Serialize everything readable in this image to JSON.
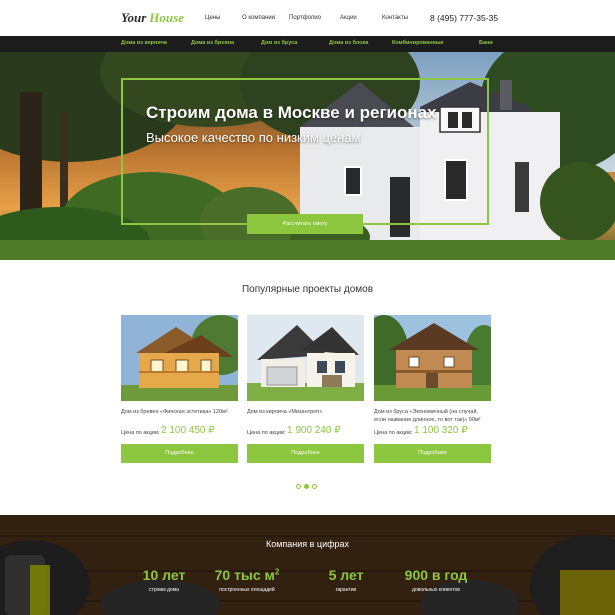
{
  "header": {
    "logo_part1": "Your",
    "logo_part2": "House",
    "nav": [
      {
        "label": "Цены"
      },
      {
        "label": "О компании"
      },
      {
        "label": "Портфолио"
      },
      {
        "label": "Акции"
      },
      {
        "label": "Контакты"
      }
    ],
    "phone": "8 (495) 777-35-35"
  },
  "categories": [
    {
      "label": "Дома из кирпича"
    },
    {
      "label": "Дома из бревна"
    },
    {
      "label": "Дом из бруса"
    },
    {
      "label": "Дома из блока"
    },
    {
      "label": "Комбинированные"
    },
    {
      "label": "Бани"
    }
  ],
  "hero": {
    "title": "Строим дома в Москве и регионах",
    "subtitle": "Высокое качество по низким ценам",
    "button": "Рассчитать смету"
  },
  "projects": {
    "title": "Популярные проекты домов",
    "items": [
      {
        "name": "Дом из бревен «Финская эстетика» 120м²",
        "price_label": "Цена по акции:",
        "price": "2 100 450 ₽",
        "button": "Подробнее"
      },
      {
        "name": "Дом из кирпича «Мизантроп»",
        "price_label": "Цена по акции:",
        "price": "1 900 240 ₽",
        "button": "Подробнее"
      },
      {
        "name": "Дом из бруса «Экономичный (на случай, если название длинное, то вот так)» 90м²",
        "price_label": "Цена по акции:",
        "price": "1 100 320 ₽",
        "button": "Подробнее"
      }
    ],
    "slider": {
      "count": 3,
      "active": 2
    }
  },
  "stats": {
    "title": "Компания в цифрах",
    "items": [
      {
        "value": "10 лет",
        "sup": "",
        "label": "строим дома"
      },
      {
        "value": "70 тыс м",
        "sup": "2",
        "label": "построенных площадей"
      },
      {
        "value": "5 лет",
        "sup": "",
        "label": "гарантии"
      },
      {
        "value": "900 в год",
        "sup": "",
        "label": "довольных клиентов"
      }
    ]
  },
  "colors": {
    "accent": "#8dc63f",
    "dark": "#1c1c1c"
  }
}
